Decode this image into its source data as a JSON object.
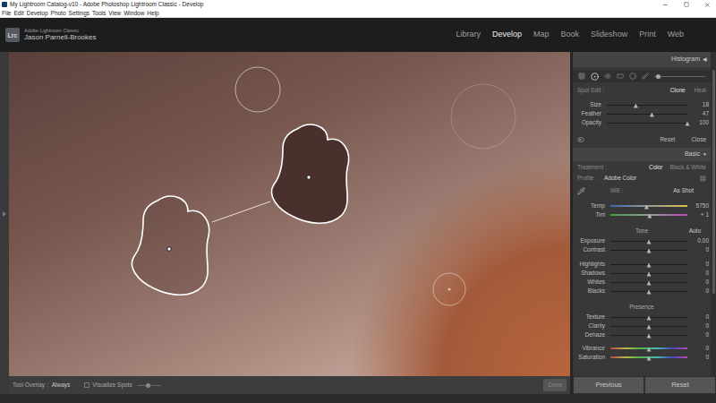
{
  "window": {
    "title": "My Lightroom Catalog-v10 - Adobe Photoshop Lightroom Classic - Develop"
  },
  "menu": [
    "File",
    "Edit",
    "Develop",
    "Photo",
    "Settings",
    "Tools",
    "View",
    "Window",
    "Help"
  ],
  "identity": {
    "logo": "Lrc",
    "product": "Adobe Lightroom Classic",
    "user": "Jason Parnell-Brookes"
  },
  "modules": [
    {
      "label": "Library",
      "selected": false
    },
    {
      "label": "Develop",
      "selected": true
    },
    {
      "label": "Map",
      "selected": false
    },
    {
      "label": "Book",
      "selected": false
    },
    {
      "label": "Slideshow",
      "selected": false
    },
    {
      "label": "Print",
      "selected": false
    },
    {
      "label": "Web",
      "selected": false
    }
  ],
  "histogram": {
    "title": "Histogram",
    "arrow": "◀"
  },
  "spot_edit": {
    "label": "Spot Edit :",
    "modes": [
      {
        "label": "Clone",
        "selected": true
      },
      {
        "label": "Heal",
        "selected": false
      }
    ],
    "sliders": [
      {
        "label": "Size",
        "value": "18",
        "level": 0.36,
        "kind": "plain"
      },
      {
        "label": "Feather",
        "value": "47",
        "level": 0.56,
        "kind": "plain"
      },
      {
        "label": "Opacity",
        "value": "100",
        "level": 1,
        "kind": "plain"
      }
    ],
    "buttons": [
      "Reset",
      "Close"
    ]
  },
  "basic": {
    "title": "Basic",
    "arrow": "▼",
    "treatment": {
      "label": "Treatment :",
      "options": [
        {
          "label": "Color",
          "selected": true
        },
        {
          "label": "Black & White",
          "selected": false
        }
      ]
    },
    "profile": {
      "label": "Profile :",
      "value": "Adobe Color"
    },
    "wb": {
      "label": "WB :",
      "value": "As Shot",
      "sliders": [
        {
          "label": "Temp",
          "value": "5750",
          "level": 0.47,
          "kind": "temp"
        },
        {
          "label": "Tint",
          "value": "+ 1",
          "level": 0.51,
          "kind": "tint"
        }
      ]
    },
    "tone": {
      "title": "Tone",
      "action": "Auto",
      "sections": [
        [
          {
            "label": "Exposure",
            "value": "0.00",
            "level": 0.5,
            "kind": "plain"
          },
          {
            "label": "Contrast",
            "value": "0",
            "level": 0.5,
            "kind": "plain"
          }
        ],
        [
          {
            "label": "Highlights",
            "value": "0",
            "level": 0.5,
            "kind": "plain"
          },
          {
            "label": "Shadows",
            "value": "0",
            "level": 0.5,
            "kind": "plain"
          },
          {
            "label": "Whites",
            "value": "0",
            "level": 0.5,
            "kind": "plain"
          },
          {
            "label": "Blacks",
            "value": "0",
            "level": 0.5,
            "kind": "plain"
          }
        ]
      ]
    },
    "presence": {
      "title": "Presence",
      "sections": [
        [
          {
            "label": "Texture",
            "value": "0",
            "level": 0.5,
            "kind": "plain"
          },
          {
            "label": "Clarity",
            "value": "0",
            "level": 0.5,
            "kind": "plain"
          },
          {
            "label": "Dehaze",
            "value": "0",
            "level": 0.5,
            "kind": "plain"
          }
        ],
        [
          {
            "label": "Vibrance",
            "value": "0",
            "level": 0.5,
            "kind": "color"
          },
          {
            "label": "Saturation",
            "value": "0",
            "level": 0.5,
            "kind": "color"
          }
        ]
      ]
    }
  },
  "toolbar": {
    "overlay_label": "Tool Overlay :",
    "overlay_value": "Always",
    "visualize": {
      "label": "Visualize Spots",
      "checked": false,
      "level": 0.45
    },
    "done": {
      "label": "Done",
      "disabled": true
    }
  },
  "footer": [
    "Previous",
    "Reset"
  ]
}
